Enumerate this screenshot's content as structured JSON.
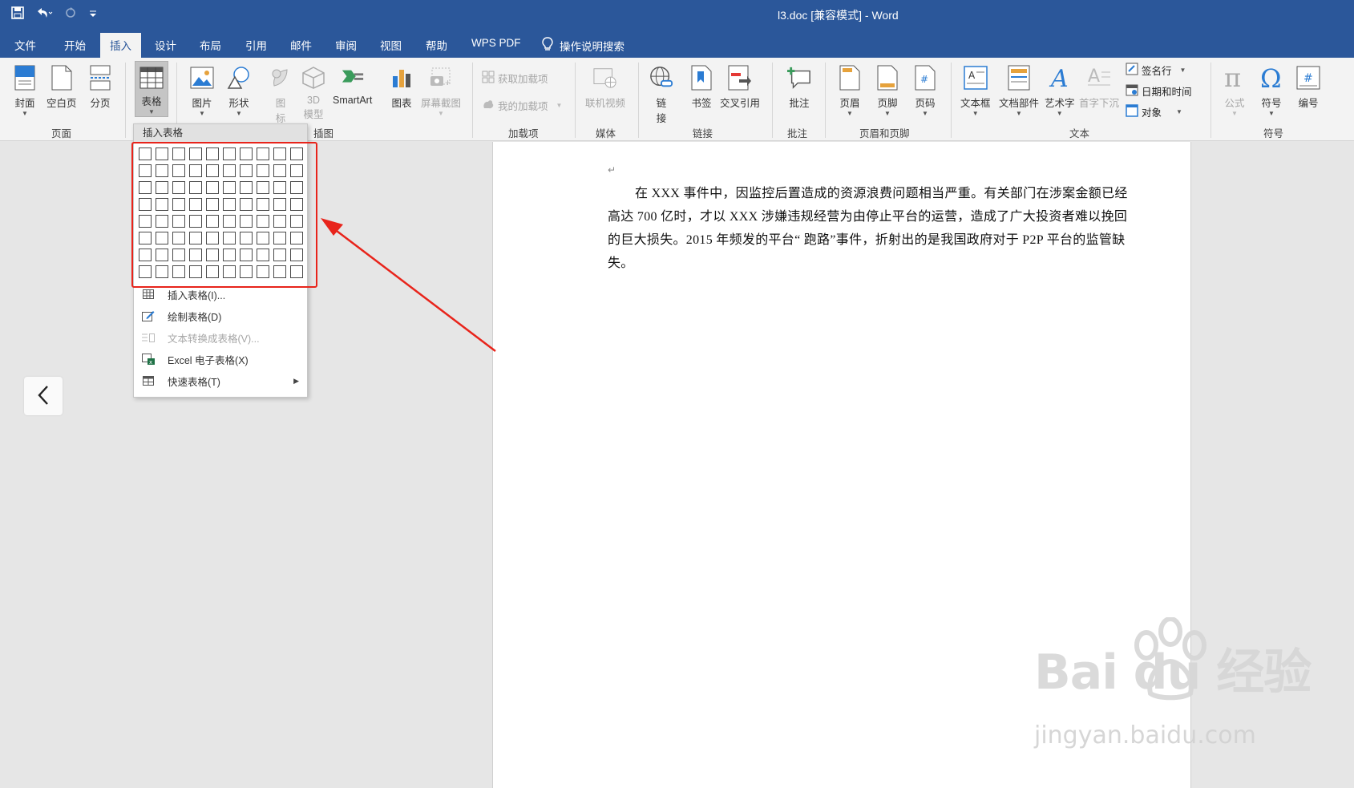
{
  "window": {
    "title": "l3.doc [兼容模式]  -  Word"
  },
  "quick_access": {
    "save_icon": "save-icon",
    "undo_icon": "undo-icon",
    "redo_icon": "redo-icon",
    "customize_icon": "customize-icon"
  },
  "tabs": [
    {
      "label": "文件"
    },
    {
      "label": "开始"
    },
    {
      "label": "插入"
    },
    {
      "label": "设计"
    },
    {
      "label": "布局"
    },
    {
      "label": "引用"
    },
    {
      "label": "邮件"
    },
    {
      "label": "审阅"
    },
    {
      "label": "视图"
    },
    {
      "label": "帮助"
    },
    {
      "label": "WPS PDF"
    }
  ],
  "tell_me": "操作说明搜索",
  "ribbon": {
    "pages": {
      "cover": "封面",
      "blank": "空白页",
      "break": "分页",
      "group": "页面"
    },
    "tables": {
      "table": "表格"
    },
    "illustrations": {
      "pictures": "图片",
      "shapes": "形状",
      "icons_l1": "图",
      "icons_l2": "标",
      "models_l1": "3D",
      "models_l2": "模型",
      "smartart": "SmartArt",
      "chart": "图表",
      "screenshot": "屏幕截图",
      "group": "插图"
    },
    "addins": {
      "get": "获取加载项",
      "my": "我的加载项",
      "group": "加载项"
    },
    "media": {
      "video": "联机视频",
      "group": "媒体"
    },
    "links": {
      "link_l1": "链",
      "link_l2": "接",
      "bookmark": "书签",
      "crossref": "交叉引用",
      "group": "链接"
    },
    "comments": {
      "comment": "批注",
      "group": "批注"
    },
    "header_footer": {
      "header": "页眉",
      "footer": "页脚",
      "page_number": "页码",
      "group": "页眉和页脚"
    },
    "text": {
      "textbox": "文本框",
      "quickparts": "文档部件",
      "wordart": "艺术字",
      "dropcap": "首字下沉",
      "signature": "签名行",
      "datetime": "日期和时间",
      "object": "对象",
      "group": "文本"
    },
    "symbols": {
      "equation": "公式",
      "symbol": "符号",
      "number": "编号",
      "group": "符号"
    }
  },
  "dropdown": {
    "header": "插入表格",
    "grid_rows": 8,
    "grid_cols": 10,
    "items": [
      {
        "label": "插入表格(I)...",
        "enabled": true
      },
      {
        "label": "绘制表格(D)",
        "enabled": true
      },
      {
        "label": "文本转换成表格(V)...",
        "enabled": false
      },
      {
        "label": "Excel 电子表格(X)",
        "enabled": true
      },
      {
        "label": "快速表格(T)",
        "enabled": true
      }
    ]
  },
  "document": {
    "paragraph": "在 XXX 事件中，因监控后置造成的资源浪费问题相当严重。有关部门在涉案金额已经高达 700 亿时，才以 XXX 涉嫌违规经营为由停止平台的运营，造成了广大投资者难以挽回的巨大损失。2015 年频发的平台“ 跑路”事件，折射出的是我国政府对于 P2P 平台的监管缺失。"
  },
  "watermark": {
    "brand": "Bai du 经验",
    "url": "jingyan.baidu.com"
  },
  "colors": {
    "title_bar": "#2b579a",
    "highlight": "#e8241b"
  }
}
